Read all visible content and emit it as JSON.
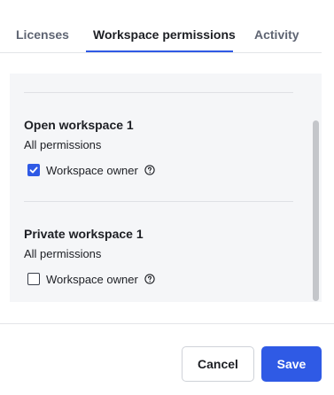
{
  "tabs": [
    {
      "label": "Licenses",
      "active": false
    },
    {
      "label": "Workspace permissions",
      "active": true
    },
    {
      "label": "Activity",
      "active": false
    }
  ],
  "workspaces": [
    {
      "name": "Open workspace 1",
      "permissions": "All permissions",
      "owner_label": "Workspace owner",
      "owner_checked": true,
      "help_icon": "question-circle-icon"
    },
    {
      "name": "Private workspace 1",
      "permissions": "All permissions",
      "owner_label": "Workspace owner",
      "owner_checked": false,
      "help_icon": "question-circle-icon"
    }
  ],
  "footer": {
    "cancel_label": "Cancel",
    "save_label": "Save"
  },
  "colors": {
    "accent": "#2f5ae5",
    "panel_bg": "#f5f6f8",
    "text": "#1d1f24",
    "muted_text": "#5f6573"
  }
}
